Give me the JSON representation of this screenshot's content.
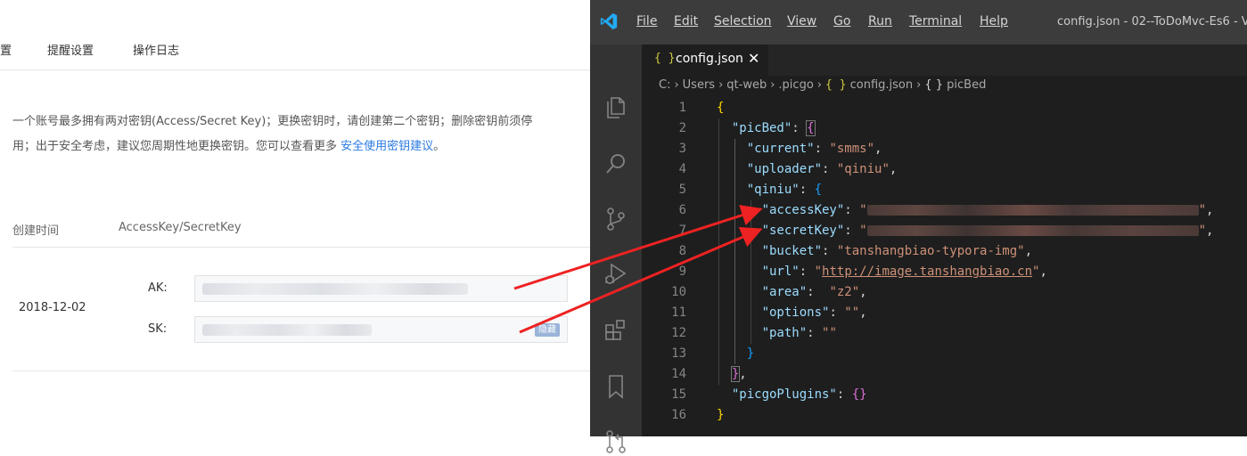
{
  "web": {
    "tabs": [
      "置",
      "提醒设置",
      "操作日志"
    ],
    "description_line1": "一个账号最多拥有两对密钥(Access/Secret Key)；更换密钥时，请创建第二个密钥；删除密钥前须停",
    "description_line2": "用；出于安全考虑，建议您周期性地更换密钥。您可以查看更多 ",
    "description_link": "安全使用密钥建议",
    "description_end": "。",
    "table_headers": {
      "created": "创建时间",
      "keys": "AccessKey/SecretKey"
    },
    "row": {
      "date": "2018-12-02",
      "ak_label": "AK:",
      "sk_label": "SK:",
      "sk_button": "隐藏"
    }
  },
  "vscode": {
    "menu": [
      "File",
      "Edit",
      "Selection",
      "View",
      "Go",
      "Run",
      "Terminal",
      "Help"
    ],
    "window_title": "config.json - 02--ToDoMvc-Es6 - V",
    "tab": {
      "braces": "{ }",
      "name": "config.json",
      "close": "✕"
    },
    "breadcrumb": [
      "C:",
      "Users",
      "qt-web",
      ".picgo",
      "config.json",
      "picBed"
    ],
    "breadcrumb_braces": [
      "{ }",
      "{ }"
    ],
    "line_numbers": [
      "1",
      "2",
      "3",
      "4",
      "5",
      "6",
      "7",
      "8",
      "9",
      "10",
      "11",
      "12",
      "13",
      "14",
      "15",
      "16"
    ],
    "code": {
      "open": "{",
      "picBed_key": "\"picBed\"",
      "current_key": "\"current\"",
      "current_val": "\"smms\"",
      "uploader_key": "\"uploader\"",
      "uploader_val": "\"qiniu\"",
      "qiniu_key": "\"qiniu\"",
      "accessKey_key": "\"accessKey\"",
      "secretKey_key": "\"secretKey\"",
      "bucket_key": "\"bucket\"",
      "bucket_val": "\"tanshangbiao-typora-img\"",
      "url_key": "\"url\"",
      "url_val_q": "\"",
      "url_val": "http://image.tanshangbiao.cn",
      "area_key": "\"area\"",
      "area_val": "\"z2\"",
      "options_key": "\"options\"",
      "options_val": "\"\"",
      "path_key": "\"path\"",
      "path_val": "\"\"",
      "picgoPlugins_key": "\"picgoPlugins\"",
      "picgoPlugins_val": "{}"
    },
    "activity_icons": [
      "explorer-icon",
      "search-icon",
      "source-control-icon",
      "run-debug-icon",
      "extensions-icon",
      "bookmark-icon",
      "pull-request-icon"
    ]
  },
  "colors": {
    "annotation_arrow": "#ee2222",
    "link": "#2a7ae2",
    "json_key": "#9cdcfe",
    "json_string": "#ce9178"
  }
}
